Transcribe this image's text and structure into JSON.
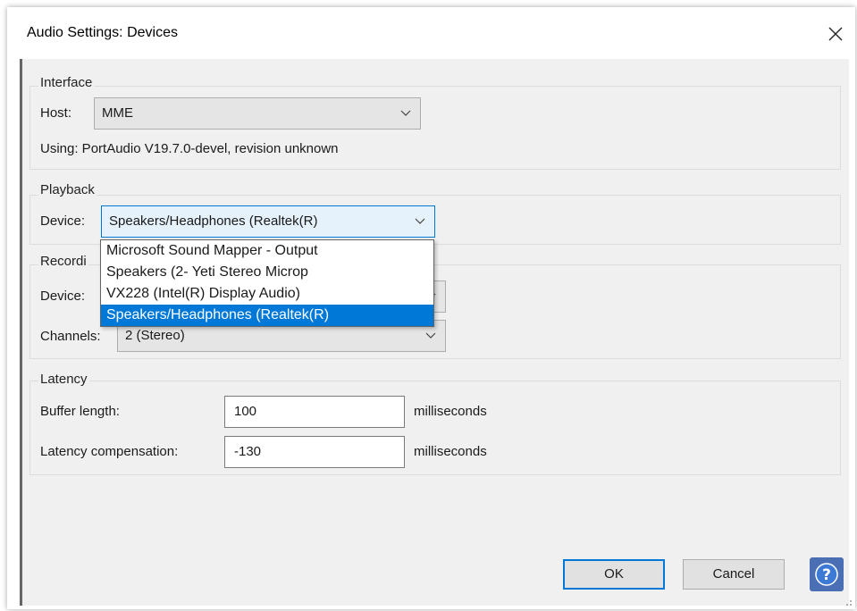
{
  "window": {
    "title": "Audio Settings: Devices"
  },
  "interface": {
    "label": "Interface",
    "host_label": "Host:",
    "host_value": "MME",
    "using_text": "Using: PortAudio V19.7.0-devel, revision unknown"
  },
  "playback": {
    "label": "Playback",
    "device_label": "Device:",
    "device_value": "Speakers/Headphones (Realtek(R)",
    "dropdown_options": [
      "Microsoft Sound Mapper - Output",
      "Speakers (2- Yeti Stereo Microp",
      "VX228 (Intel(R) Display Audio)",
      "Speakers/Headphones (Realtek(R)"
    ],
    "selected_index": 3
  },
  "recording": {
    "label": "Recordi",
    "device_label": "Device:",
    "channels_label": "Channels:",
    "channels_value": "2 (Stereo)"
  },
  "latency": {
    "label": "Latency",
    "buffer_label": "Buffer length:",
    "buffer_value": "100",
    "buffer_unit": "milliseconds",
    "compensation_label": "Latency compensation:",
    "compensation_value": "-130",
    "compensation_unit": "milliseconds"
  },
  "buttons": {
    "ok": "OK",
    "cancel": "Cancel",
    "help": "?"
  },
  "icons": {
    "close": "close-icon",
    "chevron": "chevron-down-icon",
    "help": "help-icon",
    "grip": "resize-grip-icon"
  },
  "colors": {
    "accent": "#0078d7",
    "help": "#4a6fb5",
    "panel": "#f0f0f0"
  }
}
